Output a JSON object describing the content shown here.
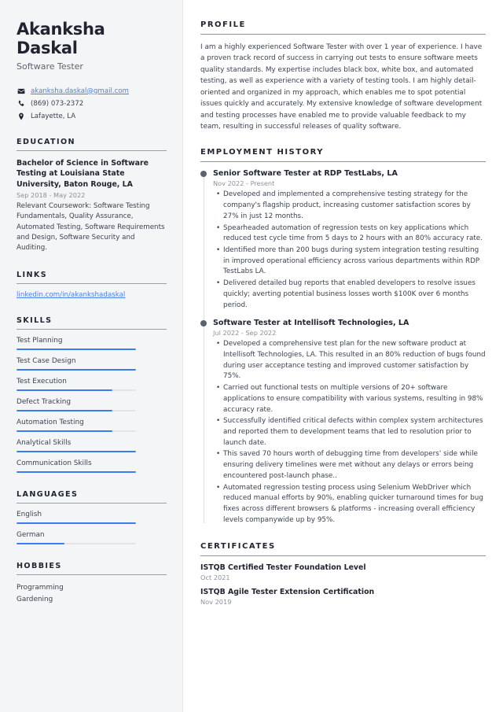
{
  "sidebar": {
    "name": "Akanksha Daskal",
    "job_title": "Software Tester",
    "contact": [
      {
        "icon": "envelope-icon",
        "value": "akanksha.daskal@gmail.com",
        "is_link": true
      },
      {
        "icon": "phone-icon",
        "value": "(869) 073-2372",
        "is_link": false
      },
      {
        "icon": "location-pin-icon",
        "value": "Lafayette, LA",
        "is_link": false
      }
    ],
    "education": {
      "heading": "EDUCATION",
      "degree": "Bachelor of Science in Software Testing at Louisiana State University, Baton Rouge, LA",
      "date": "Sep 2018 - May 2022",
      "description": "Relevant Coursework: Software Testing Fundamentals, Quality Assurance, Automated Testing, Software Requirements and Design, Software Security and Auditing."
    },
    "links": {
      "heading": "LINKS",
      "items": [
        "linkedin.com/in/akankshadaskal"
      ]
    },
    "skills": {
      "heading": "SKILLS",
      "items": [
        {
          "label": "Test Planning",
          "level": 100
        },
        {
          "label": "Test Case Design",
          "level": 100
        },
        {
          "label": "Test Execution",
          "level": 80
        },
        {
          "label": "Defect Tracking",
          "level": 80
        },
        {
          "label": "Automation Testing",
          "level": 80
        },
        {
          "label": "Analytical Skills",
          "level": 100
        },
        {
          "label": "Communication Skills",
          "level": 100
        }
      ]
    },
    "languages": {
      "heading": "LANGUAGES",
      "items": [
        {
          "label": "English",
          "level": 100
        },
        {
          "label": "German",
          "level": 40
        }
      ]
    },
    "hobbies": {
      "heading": "HOBBIES",
      "items": [
        "Programming",
        "Gardening"
      ]
    }
  },
  "main": {
    "profile": {
      "heading": "PROFILE",
      "text": "I am a highly experienced Software Tester with over 1 year of experience. I have a proven track record of success in carrying out tests to ensure software meets quality standards. My expertise includes black box, white box, and automated testing, as well as experience with a variety of testing tools. I am highly detail-oriented and organized in my approach, which enables me to spot potential issues quickly and accurately. My extensive knowledge of software development and testing processes have enabled me to provide valuable feedback to my team, resulting in successful releases of quality software."
    },
    "employment": {
      "heading": "EMPLOYMENT HISTORY",
      "jobs": [
        {
          "title": "Senior Software Tester at RDP TestLabs, LA",
          "date": "Nov 2022 - Present",
          "bullets": [
            "Developed and implemented a comprehensive testing strategy for the company's flagship product, increasing customer satisfaction scores by 27% in just 12 months.",
            "Spearheaded automation of regression tests on key applications which reduced test cycle time from 5 days to 2 hours with an 80% accuracy rate.",
            "Identified more than 200 bugs during system integration testing resulting in improved operational efficiency across various departments within RDP TestLabs LA.",
            "Delivered detailed bug reports that enabled developers to resolve issues quickly; averting potential business losses worth $100K over 6 months period."
          ]
        },
        {
          "title": "Software Tester at Intellisoft Technologies, LA",
          "date": "Jul 2022 - Sep 2022",
          "bullets": [
            "Developed a comprehensive test plan for the new software product at Intellisoft Technologies, LA. This resulted in an 80% reduction of bugs found during user acceptance testing and improved customer satisfaction by 75%.",
            "Carried out functional tests on multiple versions of 20+ software applications to ensure compatibility with various systems, resulting in 98% accuracy rate.",
            "Successfully identified critical defects within complex system architectures and reported them to development teams that led to resolution prior to launch date.",
            "This saved 70 hours worth of debugging time from developers' side while ensuring delivery timelines were met without any delays or errors being encountered post-launch phase..",
            "Automated regression testing process using Selenium WebDriver which reduced manual efforts by 90%, enabling quicker turnaround times for bug fixes across different browsers & platforms - increasing overall efficiency levels companywide up by 95%."
          ]
        }
      ]
    },
    "certificates": {
      "heading": "CERTIFICATES",
      "items": [
        {
          "name": "ISTQB Certified Tester Foundation Level",
          "date": "Oct 2021"
        },
        {
          "name": "ISTQB Agile Tester Extension Certification",
          "date": "Nov 2019"
        }
      ]
    }
  },
  "colors": {
    "accent": "#3b7df0",
    "link": "#4a7ef0",
    "heading": "#1f2430",
    "body": "#3a4250",
    "muted": "#8a9099",
    "sidebar_bg": "#f4f5f6"
  }
}
